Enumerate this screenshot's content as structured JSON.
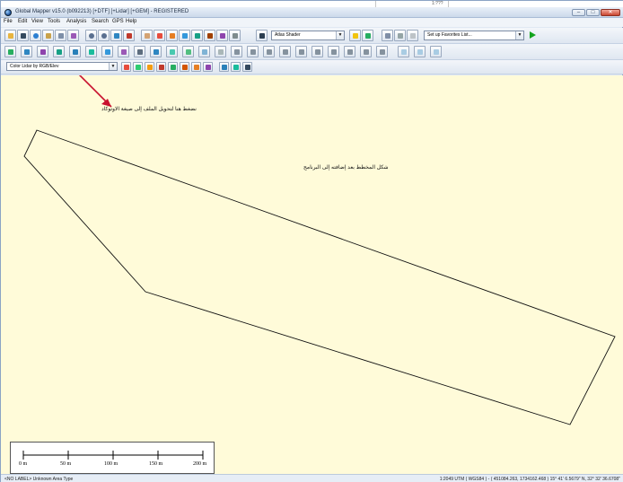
{
  "top_scale": "1:???",
  "window": {
    "title": "Global Mapper v15.0 (b092213) [+DTF] [+Lidar] [+GEM] - REGISTERED",
    "controls": {
      "minimize": "–",
      "maximize": "□",
      "close": "✕"
    }
  },
  "menu": [
    "File",
    "Edit",
    "View",
    "Tools",
    "Analysis",
    "Search",
    "GPS",
    "Help"
  ],
  "toolbar": {
    "shader_select": "Atlas Shader",
    "favorites_select": "Set up Favorites List...",
    "lidar_color_select": "Color Lidar by RGB/Elev"
  },
  "map": {
    "annotations": {
      "upload_note": "نضغط هنا لتحويل الملف إلى صيغة الاوتوكاد",
      "shape_note": "شكل المخطط بعد إضافته إلى البرنامج"
    },
    "scalebar": {
      "labels": [
        "0 m",
        "50 m",
        "100 m",
        "150 m",
        "200 m"
      ]
    }
  },
  "status": {
    "left": "<NO LABEL> Unknown Area Type",
    "right": "1:2049  UTM ( WGS84 ) - ( 451084.263, 1734162.468 )  15° 41' 6.5679\" N, 32° 32' 36.6708\""
  },
  "colors": {
    "map_background": "#fffbd9",
    "annotation_arrow": "#c8102e"
  }
}
